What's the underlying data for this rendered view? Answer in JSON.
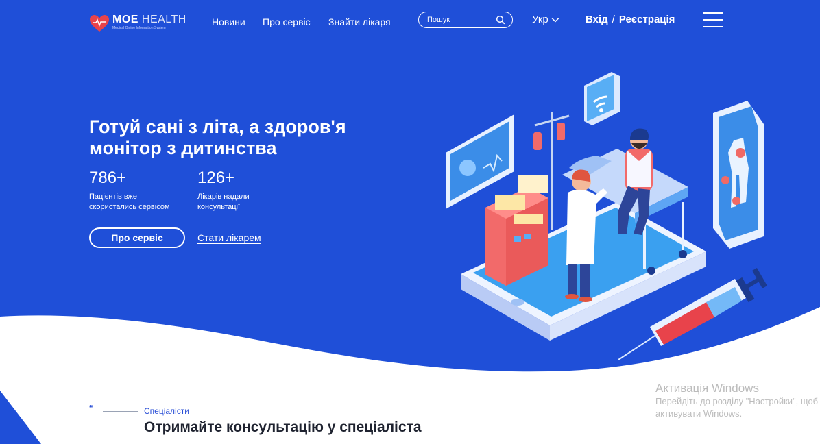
{
  "brand": {
    "name_bold": "МОЕ",
    "name_thin": "HEALTH",
    "tagline": "Medical Online Information System"
  },
  "nav": {
    "items": [
      "Новини",
      "Про сервіс",
      "Знайти лікаря"
    ]
  },
  "search": {
    "placeholder": "Пошук",
    "value": ""
  },
  "language": "Укр",
  "auth": {
    "login": "Вхід",
    "separator": "/",
    "register": "Реєстрація"
  },
  "hero": {
    "headline_line1": "Готуй сані з літа, а здоров'я",
    "headline_line2": "монітор з дитинства",
    "stats": [
      {
        "value": "786+",
        "line1": "Пацієнтів вже",
        "line2": "скористались сервісом"
      },
      {
        "value": "126+",
        "line1": "Лікарів надали",
        "line2": "консультації"
      }
    ],
    "primary_button": "Про сервіс",
    "secondary_link": "Стати лікарем"
  },
  "section": {
    "quote": "“",
    "label": "Спеціалісти",
    "title": "Отримайте консультацію у спеціаліста"
  },
  "windows_watermark": {
    "title": "Активація Windows",
    "line1": "Перейдіть до розділу \"Настройки\", щоб",
    "line2": "активувати Windows."
  },
  "colors": {
    "hero_blue": "#1f4fd8",
    "white": "#ffffff",
    "accent_red": "#e8434b"
  }
}
